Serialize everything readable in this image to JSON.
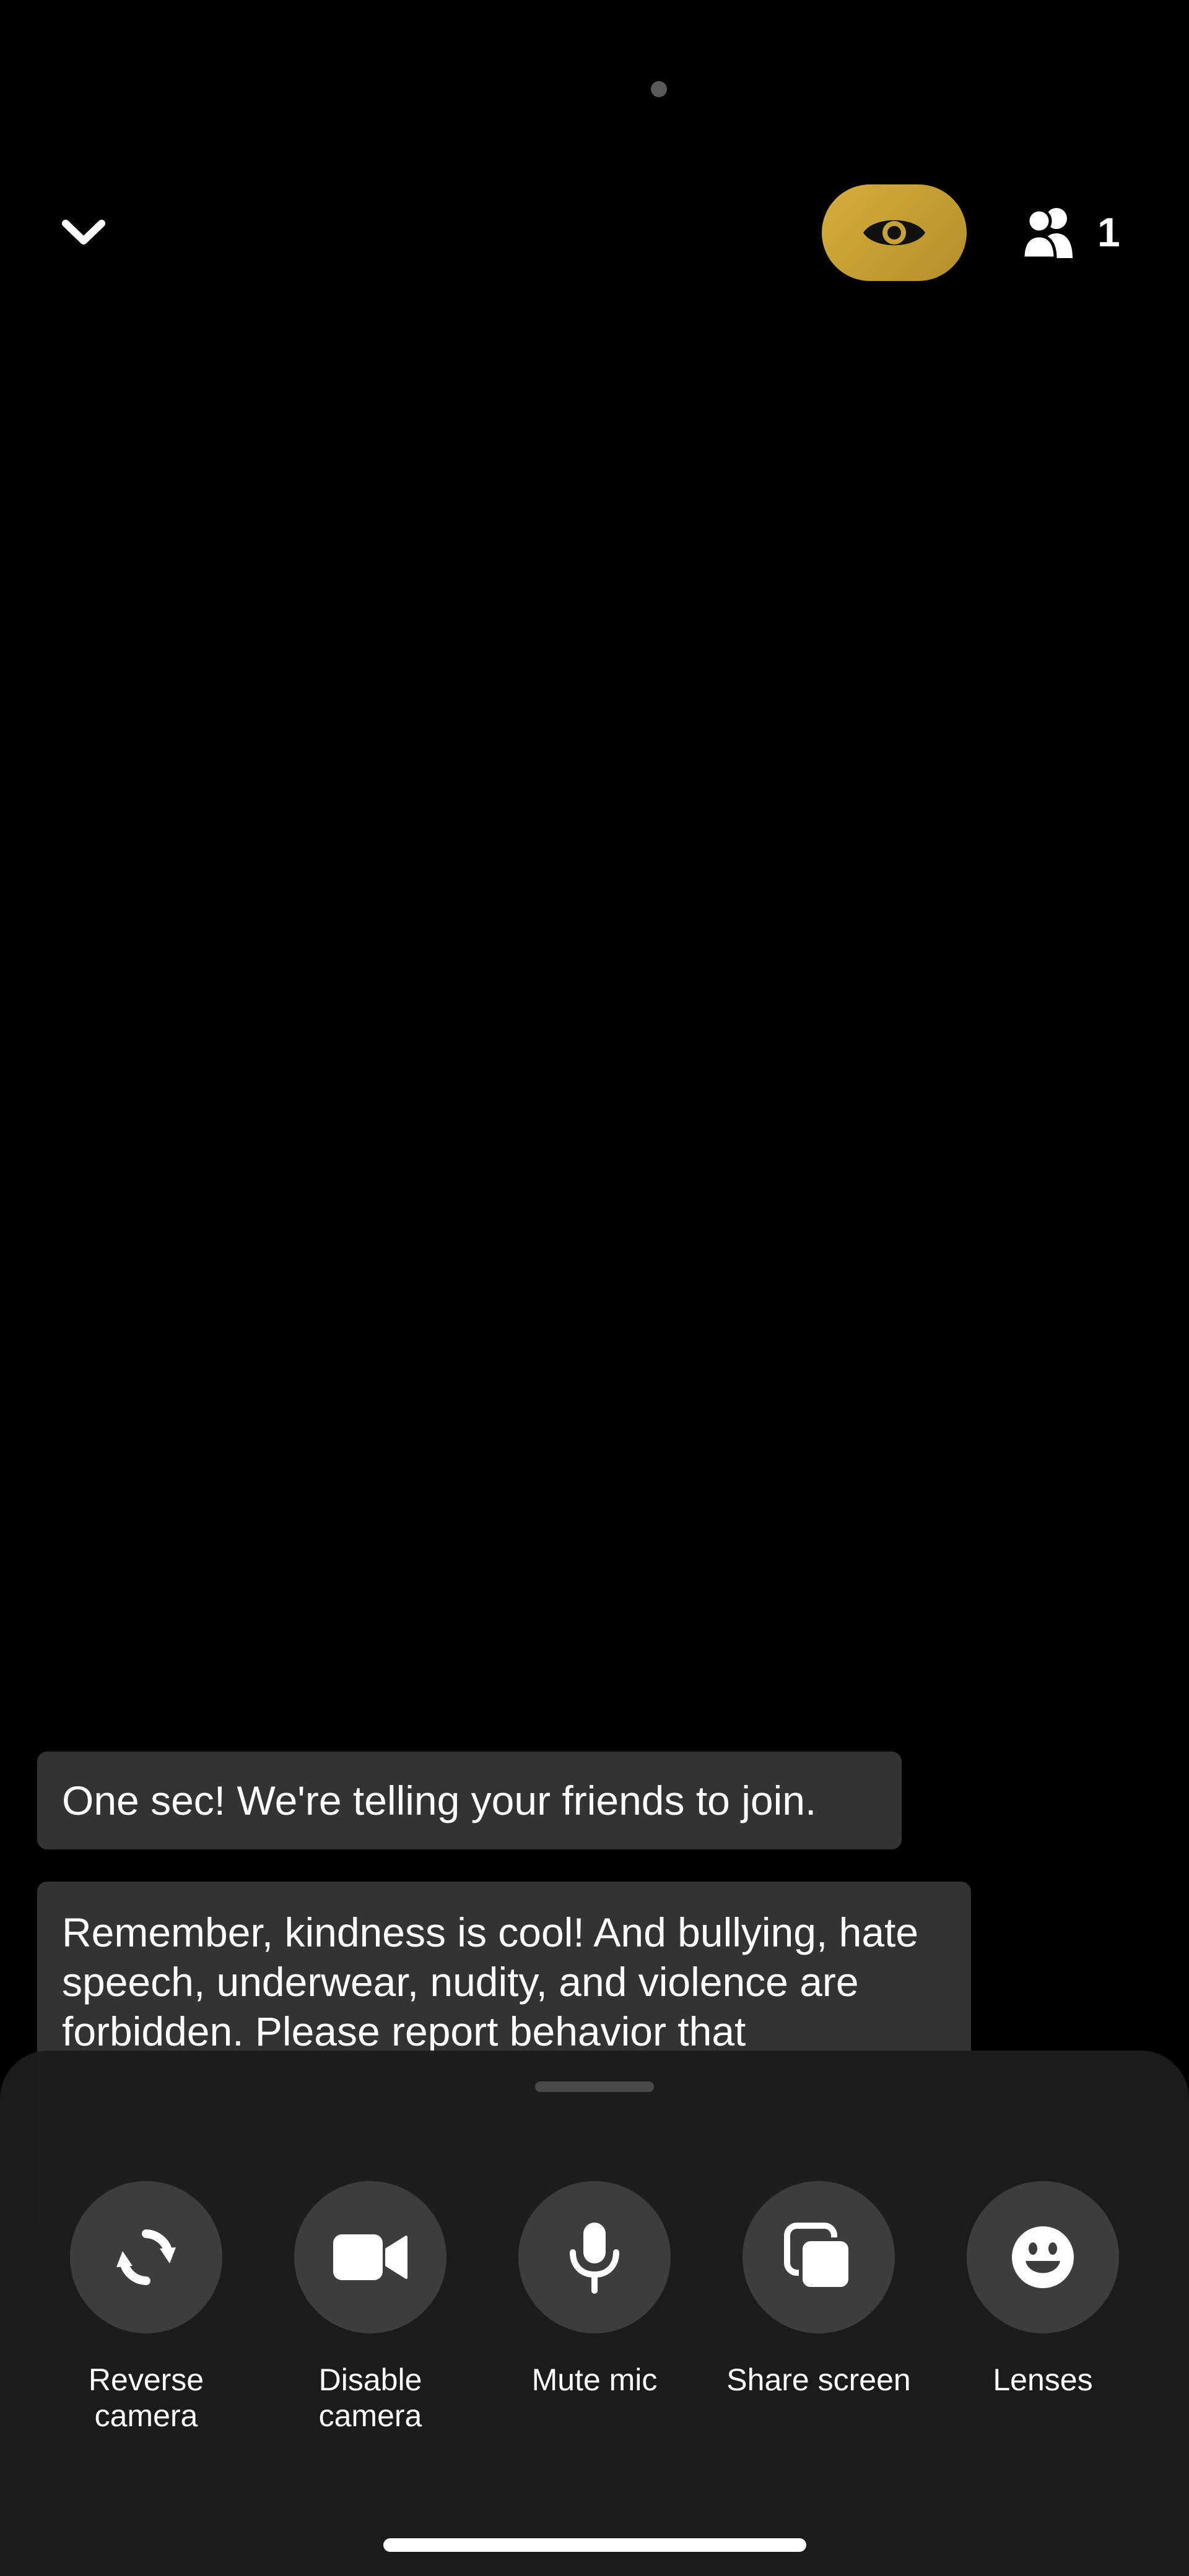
{
  "header": {
    "collapse_icon": "chevron-down-icon",
    "view_mode_icon": "eye-icon",
    "participants_icon": "people-icon",
    "participants_count": "1"
  },
  "messages": [
    {
      "text": "One sec! We're telling your friends to join."
    },
    {
      "text": "Remember, kindness is cool! And bullying, hate speech, underwear, nudity, and violence are forbidden. Please report behavior that"
    }
  ],
  "controls": [
    {
      "label": "Reverse\ncamera",
      "icon": "reverse-camera-icon"
    },
    {
      "label": "Disable\ncamera",
      "icon": "video-camera-icon"
    },
    {
      "label": "Mute mic",
      "icon": "microphone-icon"
    },
    {
      "label": "Share screen",
      "icon": "share-screen-icon"
    },
    {
      "label": "Lenses",
      "icon": "smiley-icon"
    }
  ],
  "colors": {
    "background": "#000000",
    "accent_gold": "#c9a235",
    "message_bubble": "#333333",
    "sheet": "#1c1c1c",
    "control_circle": "#3d3d3d"
  }
}
